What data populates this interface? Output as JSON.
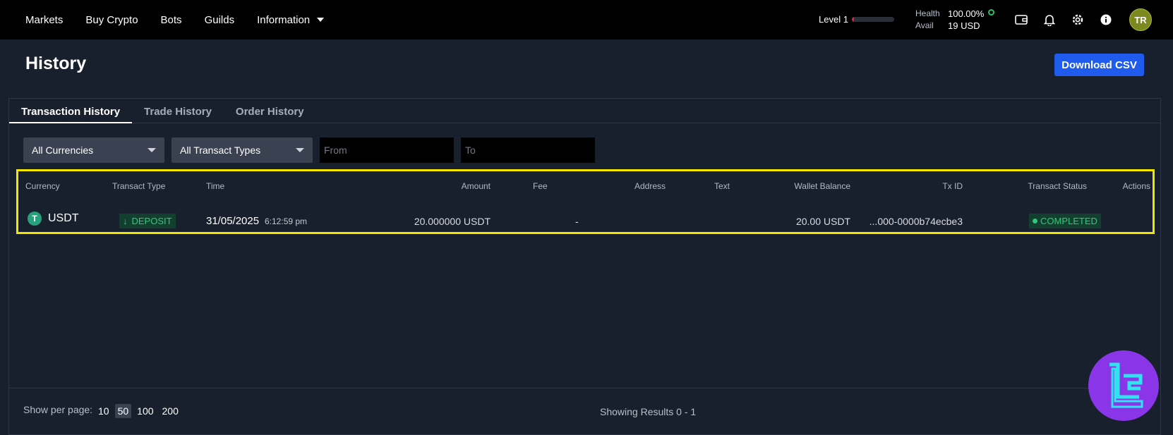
{
  "nav": {
    "items": [
      "Markets",
      "Buy Crypto",
      "Bots",
      "Guilds",
      "Information"
    ]
  },
  "account": {
    "level_label": "Level 1",
    "level_progress": 0.05,
    "health_label": "Health",
    "health_value": "100.00%",
    "avail_label": "Avail",
    "avail_value": "19 USD",
    "avatar_initials": "TR"
  },
  "page": {
    "title": "History",
    "download_label": "Download CSV"
  },
  "tabs": [
    "Transaction History",
    "Trade History",
    "Order History"
  ],
  "filters": {
    "currency": "All Currencies",
    "type": "All Transact Types",
    "from_placeholder": "From",
    "to_placeholder": "To"
  },
  "table": {
    "headers": {
      "currency": "Currency",
      "type": "Transact Type",
      "time": "Time",
      "amount": "Amount",
      "fee": "Fee",
      "address": "Address",
      "text": "Text",
      "balance": "Wallet Balance",
      "txid": "Tx ID",
      "status": "Transact Status",
      "actions": "Actions"
    },
    "rows": [
      {
        "currency": "USDT",
        "coin_symbol": "T",
        "type": "DEPOSIT",
        "date": "31/05/2025",
        "time": "6:12:59 pm",
        "amount": "20.000000 USDT",
        "fee": "-",
        "address": "",
        "text": "",
        "balance": "20.00 USDT",
        "txid": "...000-0000b74ecbe3",
        "status": "COMPLETED"
      }
    ]
  },
  "footer": {
    "per_page_label": "Show per page:",
    "options": [
      "10",
      "50",
      "100",
      "200"
    ],
    "selected": "50",
    "results": "Showing Results 0 - 1"
  },
  "colors": {
    "accent": "#1f5bec",
    "success": "#32c77a",
    "highlight": "#f2e600",
    "logo": "#8a36e8"
  }
}
